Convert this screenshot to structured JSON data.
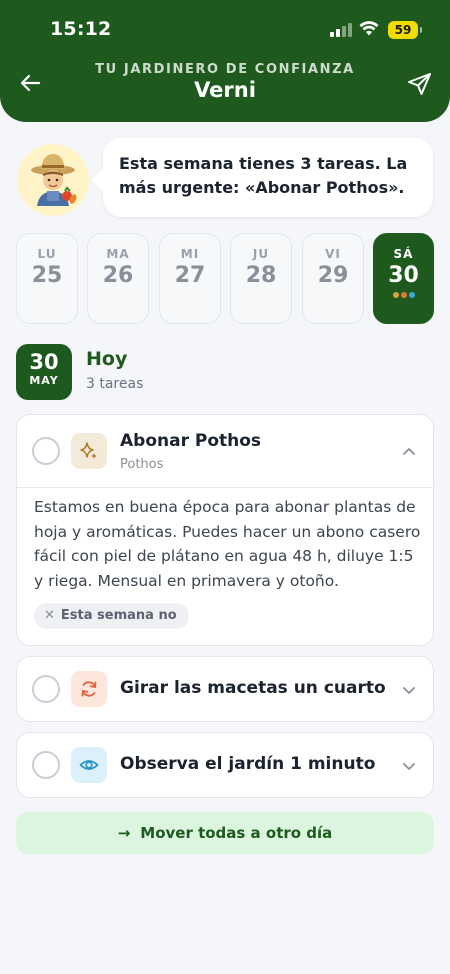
{
  "status_bar": {
    "time": "15:12",
    "battery": "59"
  },
  "header": {
    "subtitle": "TU JARDINERO DE CONFIANZA",
    "title": "Verni",
    "back_icon": "arrow-left-icon",
    "send_icon": "send-icon"
  },
  "assistant": {
    "avatar": "farmer-emoji",
    "message": "Esta semana tienes 3 tareas. La más urgente: «Abonar Pothos»."
  },
  "days": [
    {
      "name": "LU",
      "number": "25"
    },
    {
      "name": "MA",
      "number": "26"
    },
    {
      "name": "MI",
      "number": "27"
    },
    {
      "name": "JU",
      "number": "28"
    },
    {
      "name": "VI",
      "number": "29"
    },
    {
      "name": "SÁ",
      "number": "30",
      "selected": true,
      "dot_colors": [
        "#d9a43a",
        "#e07a3c",
        "#3aa8d9"
      ]
    }
  ],
  "today": {
    "badge_day": "30",
    "badge_month": "MAY",
    "label": "Hoy",
    "count": "3 tareas"
  },
  "tasks": [
    {
      "name": "Abonar Pothos",
      "plant": "Pothos",
      "icon": "sparkle-icon",
      "icon_bg": "#f4ead9",
      "icon_color": "#b07c2a",
      "expanded": true,
      "description": "Estamos en buena época para abonar plantas de hoja y aromáticas. Puedes hacer un abono casero fácil con piel de plátano en agua 48 h, diluye 1:5 y riega. Mensual en primavera y otoño.",
      "skip_label": "Esta semana no"
    },
    {
      "name": "Girar las macetas un cuarto",
      "icon": "rotate-icon",
      "icon_bg": "#fde6dc",
      "icon_color": "#e2603a",
      "expanded": false
    },
    {
      "name": "Observa el jardín 1 minuto",
      "icon": "eye-icon",
      "icon_bg": "#dcf0fb",
      "icon_color": "#2a94c9",
      "expanded": false
    }
  ],
  "move_all": {
    "label": "Mover todas a otro día"
  },
  "colors": {
    "brand_green": "#1e5a1e",
    "move_bg": "#dbf5df"
  }
}
